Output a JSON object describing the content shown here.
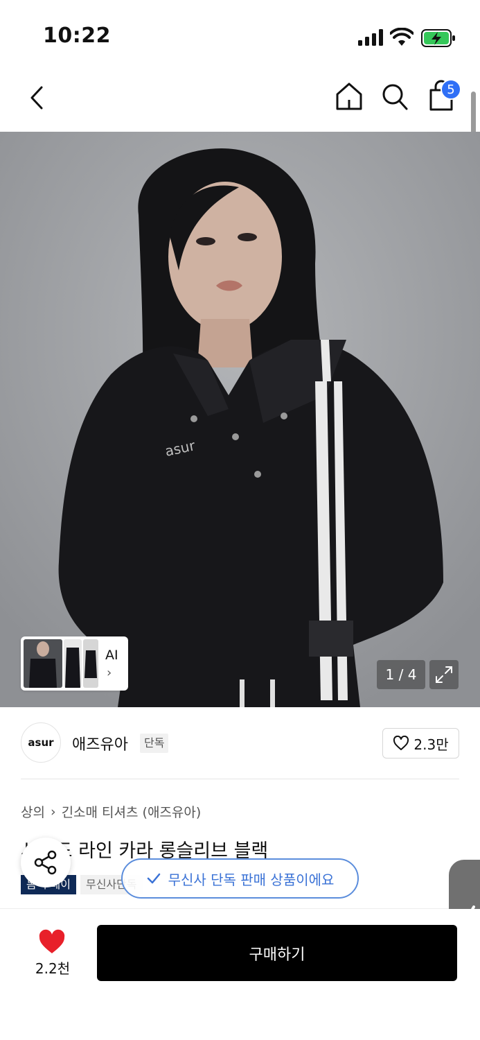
{
  "status_bar": {
    "time": "10:22"
  },
  "nav": {
    "cart_count": "5"
  },
  "hero": {
    "ai_label": "AI",
    "page_counter": "1 / 4",
    "shirt_logo": "asur"
  },
  "brand": {
    "logo_text": "asur",
    "name": "애즈유아",
    "badge": "단독",
    "likes": "2.3만"
  },
  "product": {
    "breadcrumb": [
      "상의",
      "긴소매 티셔츠 (애즈유아)"
    ],
    "title": "사이드 라인 카라 롱슬리브 블랙",
    "tags": [
      "봄 투데이",
      "무신사단독"
    ]
  },
  "toast": {
    "message": "무신사 단독 판매 상품이에요"
  },
  "bottom_bar": {
    "heart_count": "2.2천",
    "buy_label": "구매하기"
  },
  "colors": {
    "badge_blue": "#2f6ff6",
    "toast_blue": "#3a72d6",
    "heart_red": "#e8202a",
    "tag_navy": "#0f2a57"
  }
}
